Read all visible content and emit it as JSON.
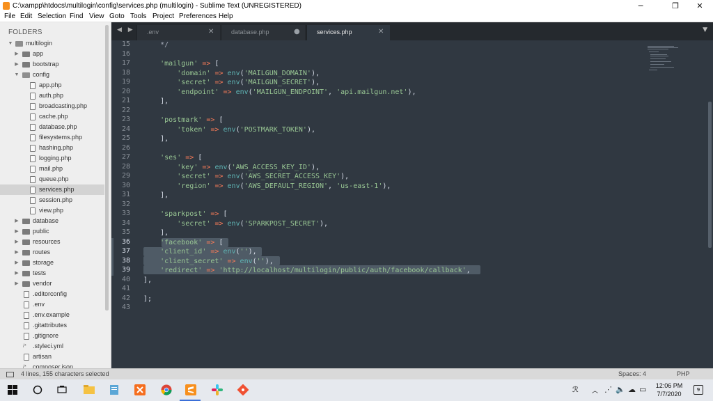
{
  "window": {
    "title": "C:\\xampp\\htdocs\\multilogin\\config\\services.php (multilogin) - Sublime Text (UNREGISTERED)",
    "minimize": "─",
    "maximize": "❐",
    "close": "✕"
  },
  "menu": [
    "File",
    "Edit",
    "Selection",
    "Find",
    "View",
    "Goto",
    "Tools",
    "Project",
    "Preferences",
    "Help"
  ],
  "sidebar": {
    "header": "FOLDERS",
    "root": "multilogin",
    "folders_top": [
      "app",
      "bootstrap"
    ],
    "open_folder": "config",
    "config_files": [
      "app.php",
      "auth.php",
      "broadcasting.php",
      "cache.php",
      "database.php",
      "filesystems.php",
      "hashing.php",
      "logging.php",
      "mail.php",
      "queue.php",
      "services.php",
      "session.php",
      "view.php"
    ],
    "selected_file": "services.php",
    "folders_bottom": [
      "database",
      "public",
      "resources",
      "routes",
      "storage",
      "tests",
      "vendor"
    ],
    "root_files": [
      ".editorconfig",
      ".env",
      ".env.example",
      ".gitattributes",
      ".gitignore",
      ".styleci.yml",
      "artisan",
      "composer.json"
    ]
  },
  "tabs": [
    {
      "label": ".env",
      "state": "close"
    },
    {
      "label": "database.php",
      "state": "dirty"
    },
    {
      "label": "services.php",
      "state": "close",
      "active": true
    }
  ],
  "tab_glyphs": {
    "nav": "◀ ▶",
    "close": "✕",
    "dirty": "●",
    "menu": "▼"
  },
  "editor": {
    "line_numbers": [
      "15",
      "16",
      "17",
      "18",
      "19",
      "20",
      "21",
      "22",
      "23",
      "24",
      "25",
      "26",
      "27",
      "28",
      "29",
      "30",
      "31",
      "32",
      "33",
      "34",
      "35",
      "36",
      "37",
      "38",
      "39",
      "40",
      "41",
      "42",
      "43"
    ],
    "active_lines": [
      "36",
      "37",
      "38",
      "39"
    ],
    "code": [
      "    */",
      "",
      "    'mailgun' => [",
      "        'domain' => env('MAILGUN_DOMAIN'),",
      "        'secret' => env('MAILGUN_SECRET'),",
      "        'endpoint' => env('MAILGUN_ENDPOINT', 'api.mailgun.net'),",
      "    ],",
      "",
      "    'postmark' => [",
      "        'token' => env('POSTMARK_TOKEN'),",
      "    ],",
      "",
      "    'ses' => [",
      "        'key' => env('AWS_ACCESS_KEY_ID'),",
      "        'secret' => env('AWS_SECRET_ACCESS_KEY'),",
      "        'region' => env('AWS_DEFAULT_REGION', 'us-east-1'),",
      "    ],",
      "",
      "    'sparkpost' => [",
      "        'secret' => env('SPARKPOST_SECRET'),",
      "    ],",
      "    'facebook' => [",
      "    'client_id' => env(''),",
      "    'client_secret' => env(''),",
      "    'redirect' => 'http://localhost/multilogin/public/auth/facebook/callback',",
      "],",
      "",
      "];",
      ""
    ]
  },
  "status": {
    "selection": "4 lines, 155 characters selected",
    "spaces": "Spaces: 4",
    "syntax": "PHP"
  },
  "taskbar": {
    "time": "12:06 PM",
    "date": "7/7/2020",
    "notifications": "9",
    "apps": [
      "start-icon",
      "cortana-icon",
      "task-view-icon",
      "file-explorer-icon",
      "notepad-icon",
      "xampp-icon",
      "chrome-icon",
      "sublime-icon",
      "slack-icon",
      "git-icon"
    ]
  },
  "colors": {
    "editor_bg": "#303841",
    "sidebar_bg": "#eeeeee",
    "string": "#99c794",
    "operator": "#f97b58",
    "function": "#5fb4b4",
    "selection": "#4f5b66"
  }
}
